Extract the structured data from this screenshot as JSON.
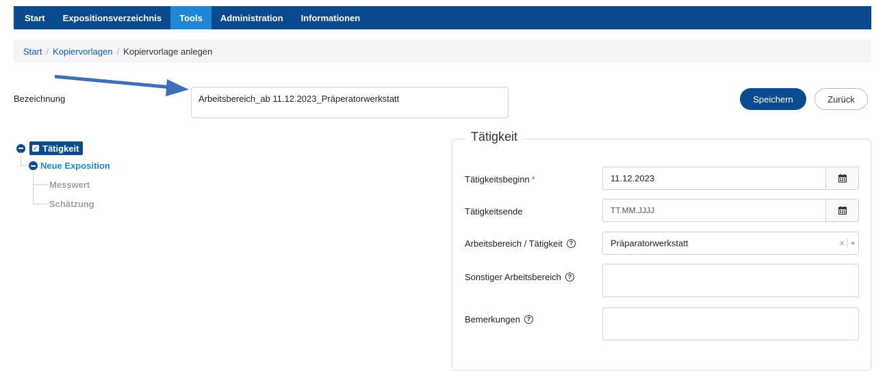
{
  "nav": {
    "items": [
      {
        "label": "Start"
      },
      {
        "label": "Expositionsverzeichnis"
      },
      {
        "label": "Tools"
      },
      {
        "label": "Administration"
      },
      {
        "label": "Informationen"
      }
    ],
    "active_index": 2
  },
  "breadcrumb": {
    "items": [
      "Start",
      "Kopiervorlagen",
      "Kopiervorlage anlegen"
    ],
    "separator": "/"
  },
  "form": {
    "bezeichnung_label": "Bezeichnung",
    "bezeichnung_value": "Arbeitsbereich_ab 11.12.2023_Präperatorwerkstatt",
    "save_label": "Speichern",
    "back_label": "Zurück"
  },
  "tree": {
    "root_label": "Tätigkeit",
    "child_label": "Neue Exposition",
    "leaves": [
      "Messwert",
      "Schätzung"
    ]
  },
  "panel": {
    "legend": "Tätigkeit",
    "start_label": "Tätigkeitsbeginn",
    "start_required": "*",
    "start_value": "11.12.2023",
    "end_label": "Tätigkeitsende",
    "end_placeholder": "TT.MM.JJJJ",
    "area_label": "Arbeitsbereich / Tätigkeit",
    "area_value": "Präparatorwerkstatt",
    "clear_glyph": "×",
    "other_label": "Sonstiger Arbeitsbereich",
    "other_value": "",
    "remarks_label": "Bemerkungen",
    "remarks_value": "",
    "help_glyph": "?"
  },
  "colors": {
    "nav_bg": "#0a4a8f",
    "nav_active": "#1e88d6",
    "link": "#0b5db5",
    "required": "#d9534f",
    "arrow": "#3f6fb5"
  }
}
